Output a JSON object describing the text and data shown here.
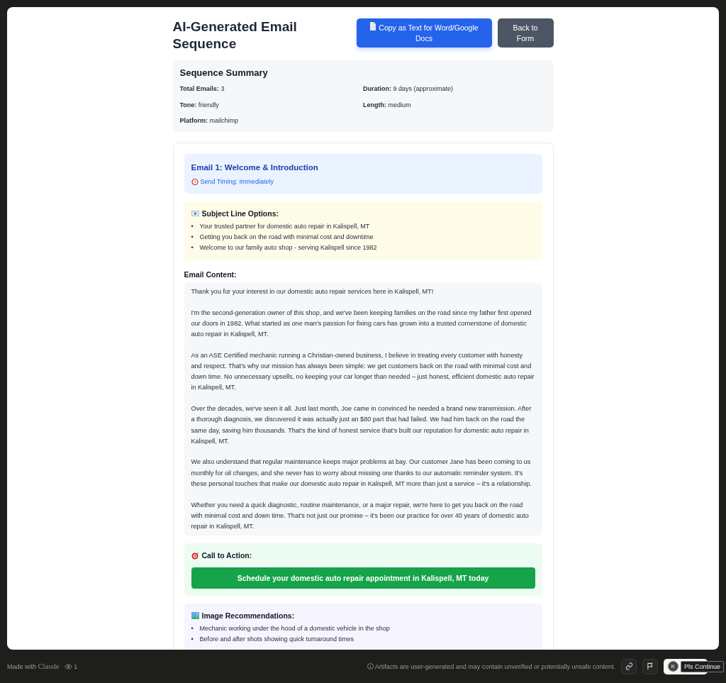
{
  "header": {
    "title": "AI-Generated Email Sequence",
    "buttons": [
      {
        "kind": "primary",
        "label": "Copy as Text for Word/Google Docs"
      },
      {
        "kind": "secondary",
        "label": "Back to Form"
      }
    ]
  },
  "summary": {
    "title": "Sequence Summary",
    "items": [
      {
        "label": "Total Emails:",
        "value": "3"
      },
      {
        "label": "Duration:",
        "value": "9 days (approximate)"
      },
      {
        "label": "Tone:",
        "value": "friendly"
      },
      {
        "label": "Length:",
        "value": "medium"
      },
      {
        "label": "Platform:",
        "value": "mailchimp"
      }
    ]
  },
  "email": {
    "title": "Email 1: Welcome & Introduction",
    "timing": "Send Timing: Immediately",
    "subject_heading": "Subject Line Options:",
    "subjects": {
      "marker": "•",
      "items": [
        "Your trusted partner for domestic auto repair in Kalispell, MT",
        "Getting you back on the road with minimal cost and downtime",
        "Welcome to our family auto shop - serving Kalispell since 1982"
      ]
    },
    "content_heading": "Email Content:",
    "paragraphs": [
      "Thank you for your interest in our domestic auto repair services here in Kalispell, MT!",
      "I'm the second-generation owner of this shop, and we've been keeping families on the road since my father first opened our doors in 1982. What started as one man's passion for fixing cars has grown into a trusted cornerstone of domestic auto repair in Kalispell, MT.",
      "As an ASE Certified mechanic running a Christian-owned business, I believe in treating every customer with honesty and respect. That's why our mission has always been simple: we get customers back on the road with minimal cost and down time. No unnecessary upsells, no keeping your car longer than needed – just honest, efficient domestic auto repair in Kalispell, MT.",
      "Over the decades, we've seen it all. Just last month, Joe came in convinced he needed a brand new transmission. After a thorough diagnosis, we discovered it was actually just an $80 part that had failed. We had him back on the road the same day, saving him thousands. That's the kind of honest service that's built our reputation for domestic auto repair in Kalispell, MT.",
      "We also understand that regular maintenance keeps major problems at bay. Our customer Jane has been coming to us monthly for oil changes, and she never has to worry about missing one thanks to our automatic reminder system. It's these personal touches that make our domestic auto repair in Kalispell, MT more than just a service – it's a relationship.",
      "Whether you need a quick diagnostic, routine maintenance, or a major repair, we're here to get you back on the road with minimal cost and down time. That's not just our promise – it's been our practice for over 40 years of domestic auto repair in Kalispell, MT."
    ],
    "cta_heading": "Call to Action:",
    "cta_button": "Schedule your domestic auto repair appointment in Kalispell, MT today",
    "images_heading": "Image Recommendations:",
    "images": {
      "marker": "•",
      "items": [
        "Mechanic working under the hood of a domestic vehicle in the shop",
        "Before and after shots showing quick turnaround times"
      ]
    }
  },
  "footer": {
    "made_with": "Made with",
    "brand": "Claude",
    "views": "1",
    "notice": "Artifacts are user-generated and may contain unverified or potentially unsafe content.",
    "badge_letter": "K",
    "badge_label": "Pls Continue"
  }
}
